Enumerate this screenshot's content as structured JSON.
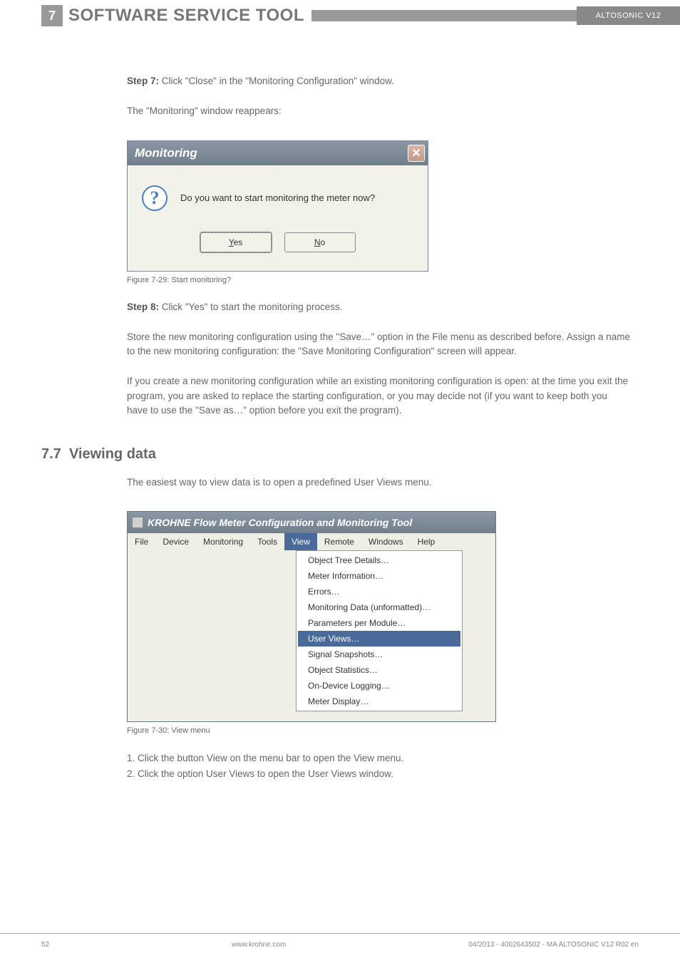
{
  "header": {
    "chapter_num": "7",
    "title": "SOFTWARE SERVICE TOOL",
    "product": "ALTOSONIC V12"
  },
  "step7": {
    "label": "Step 7:",
    "text": " Click \"Close\" in the \"Monitoring Configuration\" window."
  },
  "para_reappears": "The \"Monitoring\" window reappears:",
  "dialog1": {
    "title": "Monitoring",
    "message": "Do you want to start monitoring the meter now?",
    "yes_prefix": "Y",
    "yes_rest": "es",
    "no_prefix": "N",
    "no_rest": "o"
  },
  "caption1": "Figure 7-29: Start monitoring?",
  "step8": {
    "label": "Step 8:",
    "text": " Click \"Yes\" to start the monitoring process."
  },
  "para_store": "Store the new monitoring configuration using the \"Save…\" option in the File menu as described before. Assign a name to the new monitoring configuration: the \"Save Monitoring Configuration\" screen will appear.",
  "para_ifcreate": "If you create a new monitoring configuration while an existing monitoring configuration is open: at the time you exit the program, you are asked to replace the starting configuration, or you may decide not (if you want to keep both you have to use the \"Save as…\" option before you exit the program).",
  "section": {
    "num": "7.7",
    "title": "Viewing data"
  },
  "para_easiest": "The easiest way to view data is to open a predefined User Views menu.",
  "appwin": {
    "title": "KROHNE Flow Meter Configuration and Monitoring Tool",
    "menubar": [
      "File",
      "Device",
      "Monitoring",
      "Tools",
      "View",
      "Remote",
      "Windows",
      "Help"
    ],
    "dropdown": [
      "Object Tree Details…",
      "Meter Information…",
      "Errors…",
      "Monitoring Data  (unformatted)…",
      "Parameters per Module…",
      "User Views…",
      "Signal Snapshots…",
      "Object Statistics…",
      "On-Device Logging…",
      "Meter Display…"
    ]
  },
  "caption2": "Figure 7-30: View menu",
  "steps_list": {
    "s1": "1. Click the button View on the menu bar to open the View menu.",
    "s2": "2. Click the option User Views to open the User Views window."
  },
  "footer": {
    "page": "52",
    "url": "www.krohne.com",
    "docid": "04/2013 - 4002643502 - MA ALTOSONIC V12 R02 en"
  }
}
